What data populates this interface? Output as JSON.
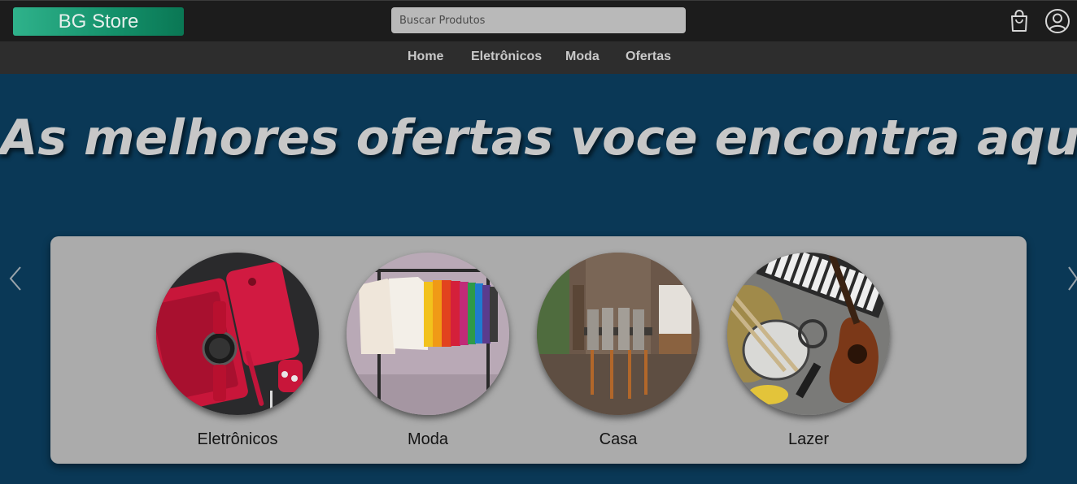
{
  "header": {
    "logo_text": "BG Store",
    "search_placeholder": "Buscar Produtos",
    "icons": [
      "shopping-bag-icon",
      "user-circle-icon"
    ]
  },
  "nav": {
    "items": [
      {
        "label": "Home"
      },
      {
        "label": "Eletrônicos"
      },
      {
        "label": "Moda"
      },
      {
        "label": "Ofertas"
      }
    ]
  },
  "hero": {
    "title": "As melhores ofertas voce encontra aqui!"
  },
  "carousel": {
    "categories": [
      {
        "label": "Eletrônicos",
        "image": "red-gadgets-photo"
      },
      {
        "label": "Moda",
        "image": "clothing-rack-photo"
      },
      {
        "label": "Casa",
        "image": "dining-room-photo"
      },
      {
        "label": "Lazer",
        "image": "music-instruments-photo"
      }
    ]
  },
  "colors": {
    "background": "#0a3856",
    "topbar": "#1c1c1c",
    "navbar": "#2d2d2d",
    "logo_gradient_start": "#2fb28b",
    "logo_gradient_end": "#0a7754",
    "panel": "#ababab"
  }
}
